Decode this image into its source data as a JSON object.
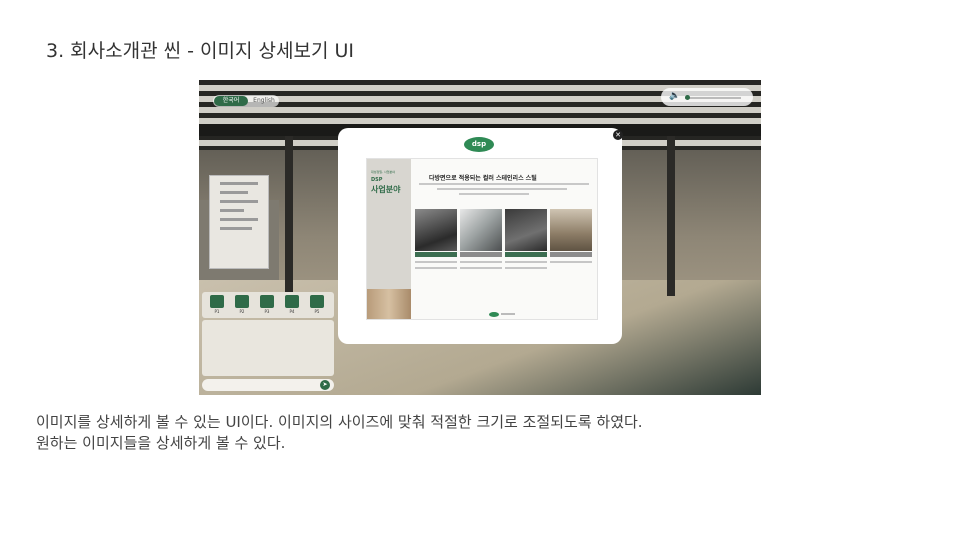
{
  "slide": {
    "title": "3. 회사소개관 씬 - 이미지 상세보기 UI"
  },
  "caption": {
    "line1": "이미지를 상세하게 볼 수 있는 UI이다. 이미지의 사이즈에 맞춰 적절한 크기로 조절되도록 하였다.",
    "line2": "원하는 이미지들을 상세하게 볼 수 있다."
  },
  "screenshot": {
    "language_active": "한국어",
    "language_other": "English",
    "volume_icon": "speaker-icon",
    "close_icon": "close-icon",
    "modal": {
      "logo": "dsp",
      "doc_subtitle": "대성정밀, 사업분야",
      "doc_brand": "DSP",
      "doc_section": "사업분야",
      "doc_heading": "다방면으로 적용되는 컬러 스테인리스 스틸"
    },
    "panel_buttons": [
      "P1",
      "P2",
      "P3",
      "P4",
      "P5"
    ],
    "chat_placeholder": "",
    "send_icon": "send-icon"
  }
}
